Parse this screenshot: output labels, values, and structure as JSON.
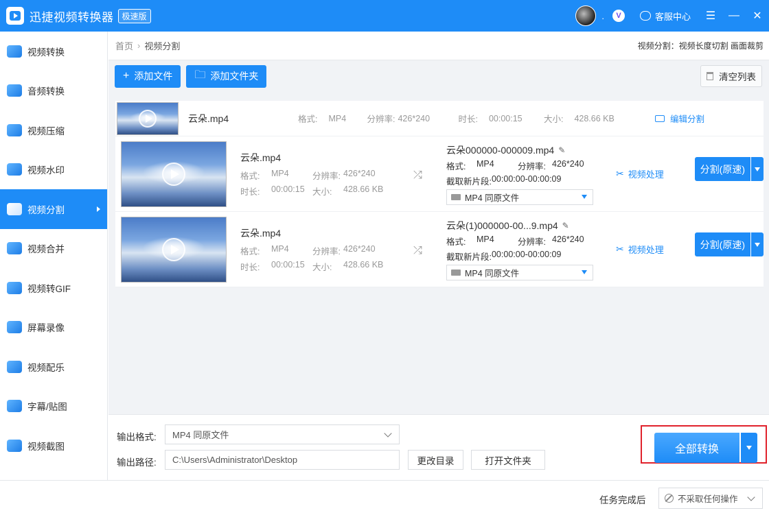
{
  "titlebar": {
    "app_title": "迅捷视频转换器",
    "edition_badge": "极速版",
    "avatar_suffix": ".",
    "service_label": "客服中心",
    "menu_glyph": "☰",
    "minimize_glyph": "—",
    "close_glyph": "✕"
  },
  "sidebar": {
    "items": [
      {
        "label": "视频转换",
        "icon": "video-convert-icon"
      },
      {
        "label": "音频转换",
        "icon": "audio-convert-icon"
      },
      {
        "label": "视频压缩",
        "icon": "video-compress-icon"
      },
      {
        "label": "视频水印",
        "icon": "video-watermark-icon"
      },
      {
        "label": "视频分割",
        "icon": "video-split-icon",
        "active": true
      },
      {
        "label": "视频合并",
        "icon": "video-merge-icon"
      },
      {
        "label": "视频转GIF",
        "icon": "video-gif-icon"
      },
      {
        "label": "屏幕录像",
        "icon": "screen-record-icon"
      },
      {
        "label": "视频配乐",
        "icon": "video-music-icon"
      },
      {
        "label": "字幕/贴图",
        "icon": "subtitle-sticker-icon"
      },
      {
        "label": "视频截图",
        "icon": "video-screenshot-icon"
      }
    ]
  },
  "breadcrumb": {
    "home": "首页",
    "separator": "›",
    "current": "视频分割",
    "modes": "视频分割：视频长度切割 画面裁剪"
  },
  "toolbar": {
    "add_file": "添加文件",
    "add_folder": "添加文件夹",
    "clear_list": "清空列表",
    "plus_glyph": "+",
    "folder_glyph": "🗀"
  },
  "file": {
    "name": "云朵.mp4",
    "format_label": "格式:",
    "format": "MP4",
    "resolution_label": "分辨率:",
    "resolution": "426*240",
    "duration_label": "时长:",
    "duration": "00:00:15",
    "size_label": "大小:",
    "size": "428.66 KB",
    "edit_split": "编辑分割"
  },
  "segments": [
    {
      "src_name": "云朵.mp4",
      "format_label": "格式:",
      "format": "MP4",
      "resolution_label": "分辨率:",
      "resolution": "426*240",
      "duration_label": "时长:",
      "duration": "00:00:15",
      "size_label": "大小:",
      "size": "428.66 KB",
      "out_name": "云朵000000-000009.mp4",
      "out_format_label": "格式:",
      "out_format": "MP4",
      "out_resolution_label": "分辨率:",
      "out_resolution": "426*240",
      "clip_label": "截取新片段:",
      "clip_range": "00:00:00-00:00:09",
      "out_select": "MP4  同原文件",
      "process_label": "视频处理",
      "split_label": "分割(原速)"
    },
    {
      "src_name": "云朵.mp4",
      "format_label": "格式:",
      "format": "MP4",
      "resolution_label": "分辨率:",
      "resolution": "426*240",
      "duration_label": "时长:",
      "duration": "00:00:15",
      "size_label": "大小:",
      "size": "428.66 KB",
      "out_name": "云朵(1)000000-00...9.mp4",
      "out_format_label": "格式:",
      "out_format": "MP4",
      "out_resolution_label": "分辨率:",
      "out_resolution": "426*240",
      "clip_label": "截取新片段:",
      "clip_range": "00:00:00-00:00:09",
      "out_select": "MP4  同原文件",
      "process_label": "视频处理",
      "split_label": "分割(原速)"
    }
  ],
  "output": {
    "format_label": "输出格式:",
    "format_value": "MP4  同原文件",
    "path_label": "输出路径:",
    "path_value": "C:\\Users\\Administrator\\Desktop",
    "change_dir": "更改目录",
    "open_folder": "打开文件夹",
    "convert_all": "全部转换"
  },
  "statusbar": {
    "after_label": "任务完成后",
    "after_value": "不采取任何操作"
  },
  "colors": {
    "accent": "#1e8cf7",
    "highlight_border": "#e0212b"
  }
}
